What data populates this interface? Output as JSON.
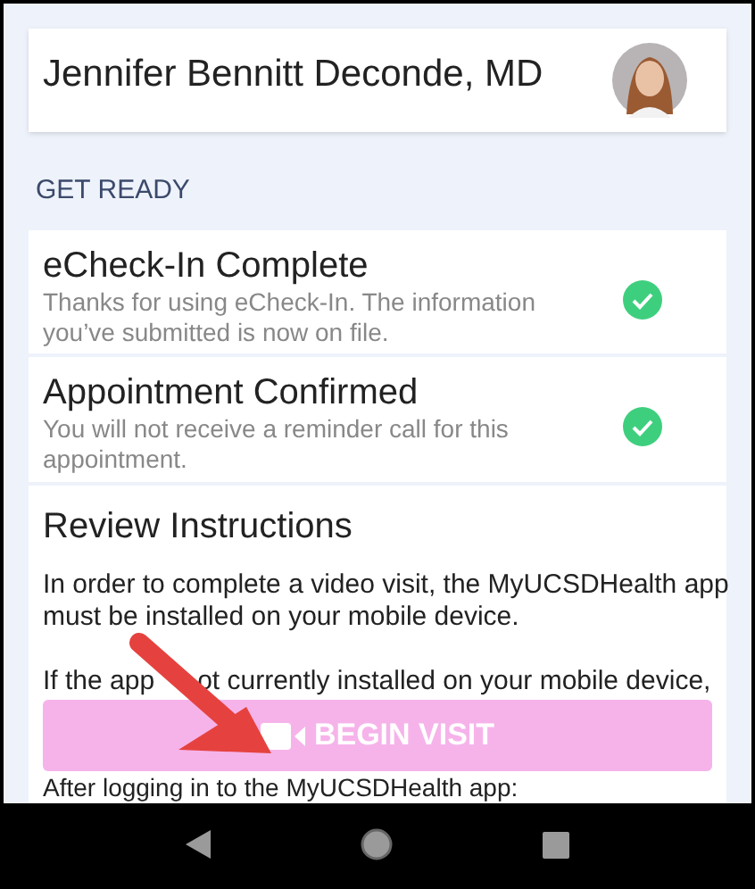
{
  "doctor": {
    "name": "Jennifer Bennitt Deconde, MD"
  },
  "section": {
    "title": "GET READY"
  },
  "steps": [
    {
      "title": "eCheck-In Complete",
      "text": "Thanks for using eCheck-In. The information you’ve submitted is now on file.",
      "done": true
    },
    {
      "title": "Appointment Confirmed",
      "text": "You will not receive a reminder call for this appointment.",
      "done": true
    }
  ],
  "instructions": {
    "title": "Review Instructions",
    "paragraphs": [
      "In order to complete a video visit, the MyUCSDHealth app must be installed on your mobile device.",
      "If the app"
    ],
    "paragraph_end": "ot currently installed on your mobile device,",
    "button": "BEGIN VISIT",
    "after": "After logging in to the MyUCSDHealth app:"
  }
}
